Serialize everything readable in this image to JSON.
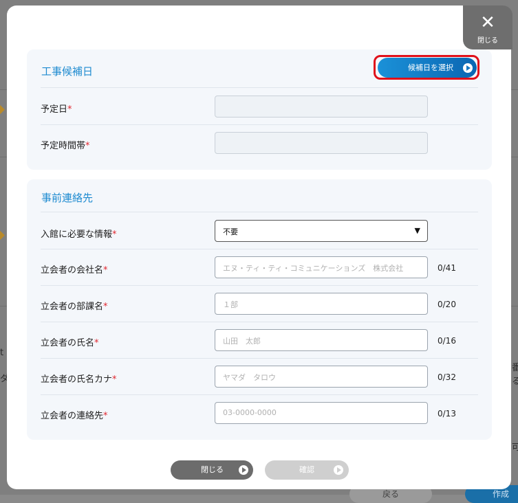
{
  "background": {
    "fragments": [
      "t",
      "ダ",
      "番",
      "る",
      "可"
    ],
    "back_label": "戻る",
    "create_label": "作成"
  },
  "modal": {
    "close_top": {
      "label": "閉じる",
      "icon": "close-icon"
    },
    "construction": {
      "title": "工事候補日",
      "select_button": "候補日を選択",
      "rows": [
        {
          "label": "予定日",
          "required": "*",
          "value": ""
        },
        {
          "label": "予定時間帯",
          "required": "*",
          "value": ""
        }
      ]
    },
    "contact": {
      "title": "事前連絡先",
      "entry_info": {
        "label": "入館に必要な情報",
        "required": "*",
        "selected": "不要"
      },
      "fields": [
        {
          "label": "立会者の会社名",
          "required": "*",
          "placeholder": "エヌ・ティ・ティ・コミュニケーションズ　株式会社",
          "value": "",
          "count": "0/41"
        },
        {
          "label": "立会者の部課名",
          "required": "*",
          "placeholder": "１部",
          "value": "",
          "count": "0/20"
        },
        {
          "label": "立会者の氏名",
          "required": "*",
          "placeholder": "山田　太郎",
          "value": "",
          "count": "0/16"
        },
        {
          "label": "立会者の氏名カナ",
          "required": "*",
          "placeholder": "ヤマダ　タロウ",
          "value": "",
          "count": "0/32"
        },
        {
          "label": "立会者の連絡先",
          "required": "*",
          "placeholder": "03-0000-0000",
          "value": "",
          "count": "0/13"
        }
      ]
    },
    "footer": {
      "close_label": "閉じる",
      "confirm_label": "確認"
    }
  },
  "colors": {
    "accent": "#1e8bd0",
    "required": "#e0262e",
    "highlight": "#e0101a"
  }
}
